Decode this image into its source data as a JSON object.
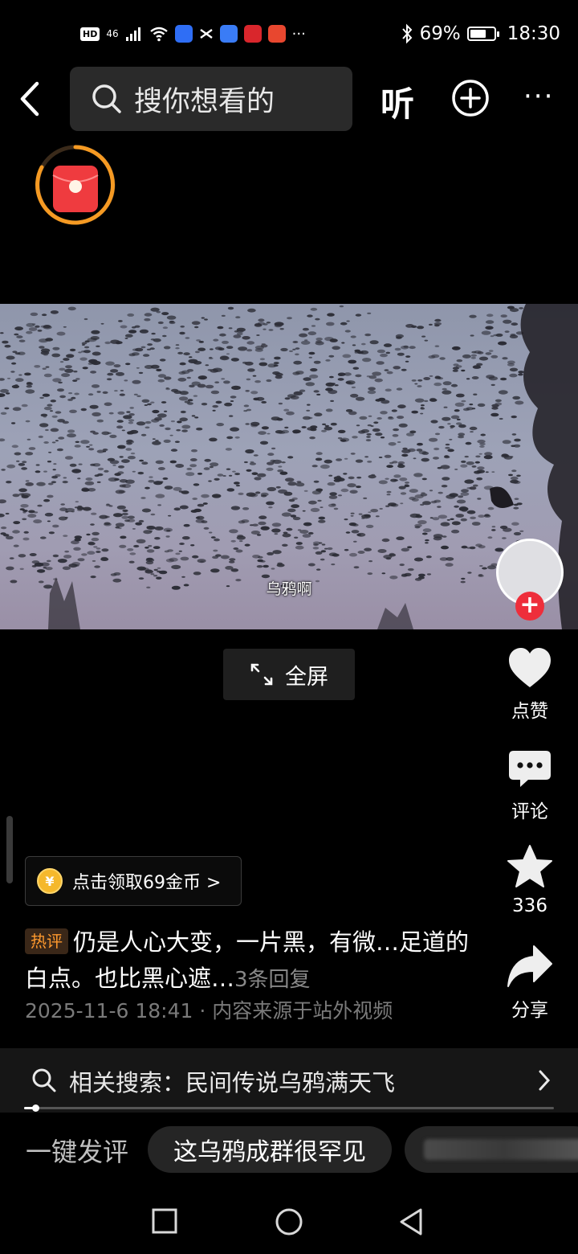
{
  "status_bar": {
    "hd": "HD",
    "network": "46",
    "battery_percent": "69%",
    "battery_level": 0.69,
    "time": "18:30",
    "more": "···"
  },
  "header": {
    "search_placeholder": "搜你想看的",
    "listen_label": "听",
    "more_label": "···"
  },
  "video": {
    "subtitle": "乌鸦啊"
  },
  "fullscreen": {
    "label": "全屏"
  },
  "actions": {
    "like_label": "点赞",
    "comment_label": "评论",
    "favorite_count": "336",
    "share_label": "分享"
  },
  "coin_banner": {
    "icon_char": "¥",
    "text": "点击领取69金币 >"
  },
  "hot_comment": {
    "tag": "热评",
    "text": "仍是人心大变，一片黑，有微…足道的白点。也比黑心遮…",
    "replies": "3条回复",
    "meta": "2025-11-6 18:41 · 内容来源于站外视频"
  },
  "related_search": {
    "label": "相关搜索：民间传说乌鸦满天飞"
  },
  "quick_comment": {
    "label": "一键发评",
    "chips": [
      "这乌鸦成群很罕见"
    ]
  },
  "colors": {
    "accent_red": "#ee2e3b",
    "ring_orange": "#f59a23",
    "hot_tag_orange": "#ff9a2e",
    "coin_gold": "#f5b82c"
  }
}
